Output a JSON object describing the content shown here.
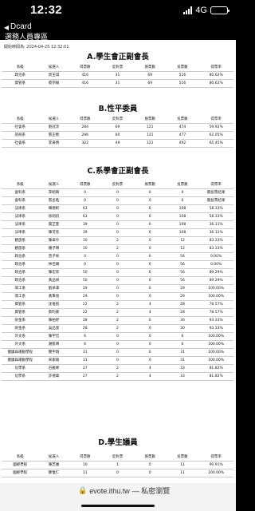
{
  "status_bar": {
    "time": "12:32",
    "network": "4G",
    "battery_level": 0.7
  },
  "nav": {
    "back_label": "Dcard",
    "title": "選務人員專區"
  },
  "print_time": "開始時間為: 2024-04-25 12:32:01",
  "section_a": {
    "title": "A.學生會正副會長",
    "headers": [
      "系級",
      "候選人",
      "得票數",
      "反對票",
      "廢票數",
      "投票數",
      "得票率"
    ],
    "rows": [
      [
        "政治系",
        "周玉琪",
        "416",
        "31",
        "69",
        "516",
        "80.62%"
      ],
      [
        "資管系",
        "蔡宗翰",
        "416",
        "31",
        "69",
        "516",
        "80.62%"
      ]
    ]
  },
  "section_b": {
    "title": "B.性平委員",
    "headers": [
      "系級",
      "候選人",
      "得票數",
      "反對票",
      "廢票數",
      "投票數",
      "得票率"
    ],
    "rows": [
      [
        "社會系",
        "劉冠淳",
        "284",
        "69",
        "121",
        "474",
        "59.92%"
      ],
      [
        "諮商系",
        "張正楷",
        "296",
        "60",
        "121",
        "477",
        "62.05%"
      ],
      [
        "社會系",
        "李采倩",
        "322",
        "49",
        "121",
        "492",
        "65.45%"
      ]
    ]
  },
  "section_c": {
    "title": "C.系學會正副會長",
    "headers": [
      "系級",
      "候選人",
      "得票數",
      "反對票",
      "廢票數",
      "投票數",
      "得票率"
    ],
    "rows": [
      [
        "會科系",
        "李紹興",
        "0",
        "0",
        "0",
        "0",
        "無投票結果"
      ],
      [
        "會科系",
        "張丞皓",
        "0",
        "0",
        "0",
        "0",
        "無投票結果"
      ],
      [
        "法律系",
        "賴德軒",
        "63",
        "0",
        "6",
        "108",
        "58.33%"
      ],
      [
        "法律系",
        "徐莉鈞",
        "63",
        "0",
        "6",
        "108",
        "58.33%"
      ],
      [
        "法律系",
        "葉芷萱",
        "39",
        "0",
        "6",
        "108",
        "36.11%"
      ],
      [
        "法律系",
        "陳可欣",
        "39",
        "0",
        "6",
        "108",
        "36.11%"
      ],
      [
        "觀旅系",
        "陳韋伶",
        "10",
        "2",
        "0",
        "12",
        "83.33%"
      ],
      [
        "觀旅系",
        "羅子晴",
        "10",
        "2",
        "0",
        "12",
        "83.33%"
      ],
      [
        "政治系",
        "曾子宥",
        "0",
        "0",
        "6",
        "56",
        "0.00%"
      ],
      [
        "政治系",
        "林佳穎",
        "0",
        "0",
        "6",
        "56",
        "0.00%"
      ],
      [
        "政治系",
        "陳宏欣",
        "50",
        "0",
        "6",
        "56",
        "89.29%"
      ],
      [
        "政治系",
        "黃品妍",
        "50",
        "0",
        "6",
        "56",
        "89.29%"
      ],
      [
        "環工系",
        "劉承澤",
        "29",
        "0",
        "0",
        "29",
        "100.00%"
      ],
      [
        "環工系",
        "黃秉恩",
        "29",
        "0",
        "0",
        "29",
        "100.00%"
      ],
      [
        "資管系",
        "沈惟凱",
        "22",
        "2",
        "4",
        "28",
        "78.57%"
      ],
      [
        "資管系",
        "蔡昀豪",
        "22",
        "2",
        "4",
        "28",
        "78.57%"
      ],
      [
        "財金系",
        "陳柏妤",
        "28",
        "2",
        "0",
        "30",
        "93.33%"
      ],
      [
        "財金系",
        "吳品潔",
        "28",
        "2",
        "0",
        "30",
        "93.33%"
      ],
      [
        "外文系",
        "陳宇哲",
        "6",
        "0",
        "0",
        "6",
        "100.00%"
      ],
      [
        "外文系",
        "謝凱晴",
        "6",
        "0",
        "0",
        "6",
        "100.00%"
      ],
      [
        "健康與運動學程",
        "簡宇翔",
        "31",
        "0",
        "0",
        "31",
        "100.00%"
      ],
      [
        "健康與運動學程",
        "宋家瑜",
        "31",
        "0",
        "0",
        "31",
        "100.00%"
      ],
      [
        "化學系",
        "石雅婷",
        "27",
        "2",
        "4",
        "33",
        "81.82%"
      ],
      [
        "化學系",
        "許德瑋",
        "27",
        "2",
        "4",
        "33",
        "81.82%"
      ]
    ]
  },
  "section_d": {
    "title": "D.學生議員",
    "headers": [
      "系級",
      "候選人",
      "得票數",
      "反對票",
      "廢票數",
      "投票數",
      "得票率"
    ],
    "rows": [
      [
        "國經學程",
        "陳芝維",
        "10",
        "1",
        "0",
        "11",
        "90.91%"
      ],
      [
        "國經學程",
        "鄭惟仁",
        "11",
        "0",
        "0",
        "11",
        "100.00%"
      ]
    ]
  },
  "bottom_bar": {
    "url": "evote.ithu.tw",
    "mode": "— 私密瀏覽"
  }
}
